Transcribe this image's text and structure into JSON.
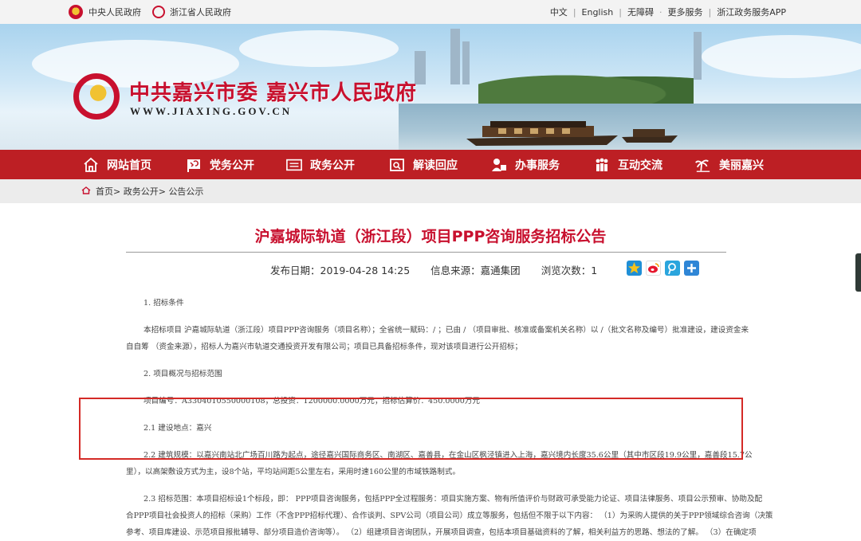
{
  "topbar": {
    "links_left": [
      "中央人民政府",
      "浙江省人民政府"
    ],
    "links_right": [
      "中文",
      "English",
      "无障碍",
      "更多服务",
      "浙江政务服务APP"
    ]
  },
  "header": {
    "title": "中共嘉兴市委 嘉兴市人民政府",
    "url": "WWW.JIAXING.GOV.CN"
  },
  "nav": {
    "items": [
      {
        "label": "网站首页",
        "icon": "home-icon"
      },
      {
        "label": "党务公开",
        "icon": "party-flag-icon"
      },
      {
        "label": "政务公开",
        "icon": "document-icon"
      },
      {
        "label": "解读回应",
        "icon": "interpretation-icon"
      },
      {
        "label": "办事服务",
        "icon": "service-icon"
      },
      {
        "label": "互动交流",
        "icon": "people-icon"
      },
      {
        "label": "美丽嘉兴",
        "icon": "palm-tree-icon"
      }
    ]
  },
  "breadcrumb": {
    "home": "首页",
    "sep1": ">",
    "section": "政务公开",
    "sep2": ">",
    "current": "公告公示"
  },
  "article": {
    "title": "沪嘉城际轨道（浙江段）项目PPP咨询服务招标公告",
    "date_label": "发布日期：",
    "date": "2019-04-28 14:25",
    "source_label": "信息来源：",
    "source": "嘉通集团",
    "views_label": "浏览次数：",
    "views": "1",
    "share_icons": [
      "qzone-star-icon",
      "weibo-icon",
      "tencent-weibo-icon",
      "more-share-plus-icon"
    ],
    "paragraphs": {
      "s1_heading": "1. 招标条件",
      "s1_l1": "本招标项目 沪嘉城际轨道（浙江段）项目PPP咨询服务（项目名称）；全省统一赋码：/ ；已由 / （项目审批、核准或备案机关名称）以 /（批文名称及编号）批准建设，建设资金来",
      "s1_l2": "自自筹 （资金来源），招标人为嘉兴市轨道交通投资开发有限公司；项目已具备招标条件，现对该项目进行公开招标；",
      "s2_heading": "2. 项目概况与招标范围",
      "s2_l1": "项目编号：A3304010550000108；总投资：1200000.0000万元；招标估算价：450.0000万元",
      "s21": "2.1 建设地点：嘉兴",
      "s22_l1": "2.2 建筑规模：以嘉兴南站北广场百川路为起点，途径嘉兴国际商务区、南湖区、嘉善县，在金山区枫泾镇进入上海，嘉兴境内长度35.6公里（其中市区段19.9公里，嘉善段15.7公",
      "s22_l2": "里），以高架敷设方式为主，设8个站，平均站间距5公里左右，采用时速160公里的市域铁路制式。",
      "s23_l1": "2.3 招标范围：本项目招标设1个标段，即： PPP项目咨询服务，包括PPP全过程服务：项目实施方案、物有所值评价与财政可承受能力论证、项目法律服务、项目公示预审、协助及配",
      "s23_l2": "合PPP项目社会投资人的招标（采购）工作（不含PPP招标代理）、合作谈判、SPV公司（项目公司）成立等服务，包括但不限于以下内容： （1）为采购人提供的关于PPP领域综合咨询（决策",
      "s23_l3": "参考、项目库建设、示范项目报批辅导、部分项目造价咨询等）。 （2）组建项目咨询团队，开展项目调查，包括本项目基础资料的了解，相关利益方的思路、想法的了解。 （3）在确定项"
    }
  },
  "colors": {
    "nav_red": "#bd1f24",
    "title_red": "#c8102e",
    "highlight_box": "#d42a26"
  }
}
